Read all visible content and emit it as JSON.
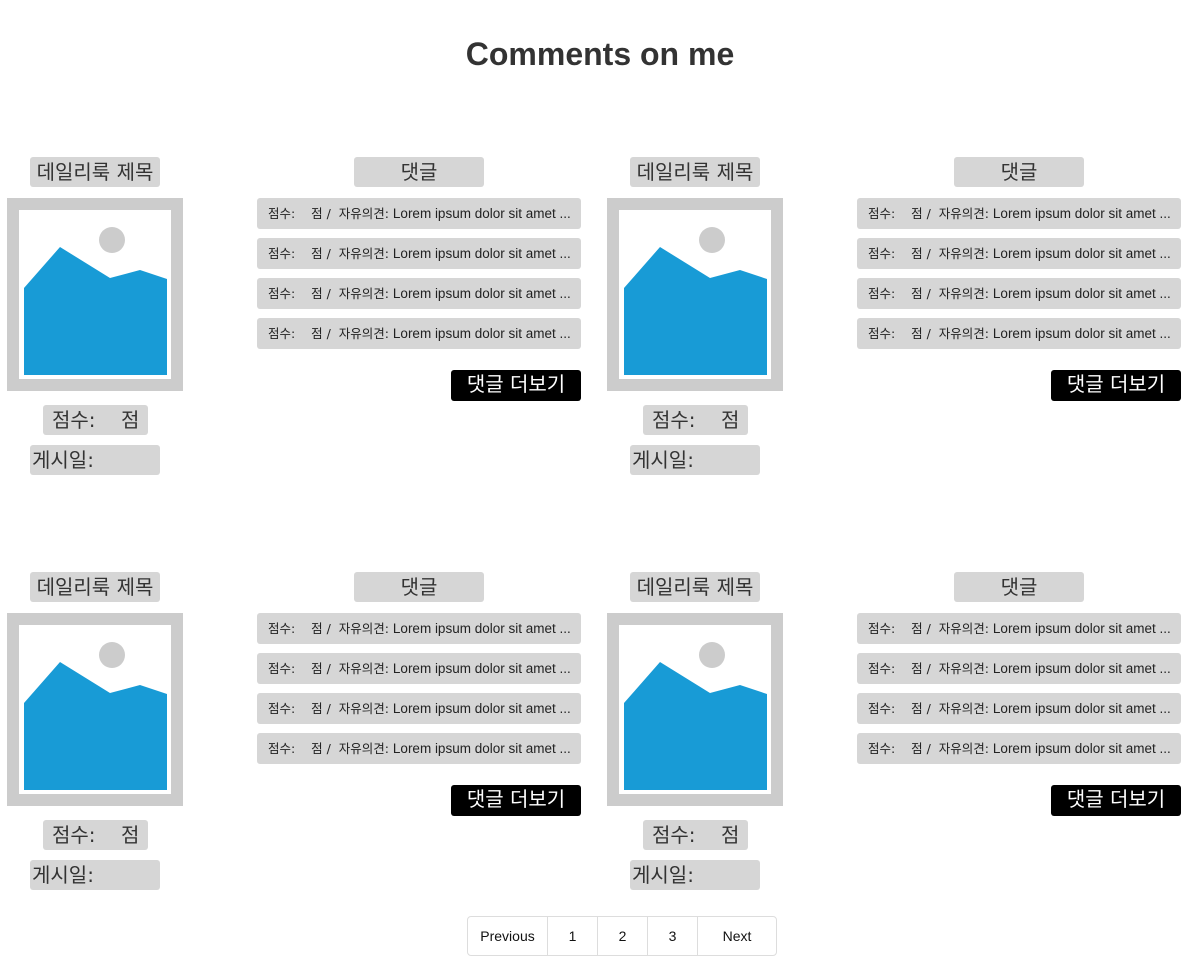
{
  "page": {
    "title": "Comments on me"
  },
  "labels": {
    "daily_title": "데일리룩 제목",
    "score": "점수:    점",
    "posted": "게시일:",
    "comments_header": "댓글",
    "more_comments": "댓글 더보기",
    "comment_prefix": "점수:    점 /  자유의견: ",
    "comment_body": "Lorem ipsum dolor sit amet ..."
  },
  "cards": [
    {
      "comments": [
        "c1",
        "c2",
        "c3",
        "c4"
      ]
    },
    {
      "comments": [
        "c1",
        "c2",
        "c3",
        "c4"
      ]
    },
    {
      "comments": [
        "c1",
        "c2",
        "c3",
        "c4"
      ]
    },
    {
      "comments": [
        "c1",
        "c2",
        "c3",
        "c4"
      ]
    }
  ],
  "pagination": {
    "previous": "Previous",
    "pages": [
      "1",
      "2",
      "3"
    ],
    "next": "Next"
  },
  "colors": {
    "image_frame": "#cccccc",
    "image_fill": "#189bd6",
    "pill_bg": "#d6d6d6",
    "button_bg": "#000000"
  },
  "icons": {
    "photo": "image-placeholder-icon"
  }
}
